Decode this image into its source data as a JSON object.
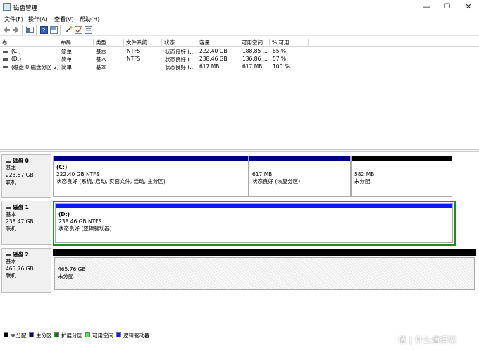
{
  "window": {
    "title": "磁盘管理",
    "controls": {
      "minimize": "—",
      "maximize": "☐",
      "close": "✕"
    }
  },
  "menu": [
    "文件(F)",
    "操作(A)",
    "查看(V)",
    "帮助(H)"
  ],
  "toolbar": [
    "back-icon",
    "forward-icon",
    "properties-icon",
    "help-icon",
    "console-icon",
    "connect-icon",
    "check-icon",
    "list-icon"
  ],
  "volume_table": {
    "columns": [
      "卷",
      "布局",
      "类型",
      "文件系统",
      "状态",
      "容量",
      "可用空间",
      "% 可用"
    ],
    "rows": [
      {
        "name": "(C:)",
        "layout": "简单",
        "type": "基本",
        "fs": "NTFS",
        "status": "状态良好 (...",
        "capacity": "222.40 GB",
        "free": "188.85 ...",
        "pct": "85 %"
      },
      {
        "name": "(D:)",
        "layout": "简单",
        "type": "基本",
        "fs": "NTFS",
        "status": "状态良好 (...",
        "capacity": "238.46 GB",
        "free": "136.86 ...",
        "pct": "57 %"
      },
      {
        "name": "(磁盘 0 磁盘分区 2)",
        "layout": "简单",
        "type": "基本",
        "fs": "",
        "status": "状态良好 (...",
        "capacity": "617 MB",
        "free": "617 MB",
        "pct": "100 %"
      }
    ]
  },
  "disks": [
    {
      "name": "磁盘 0",
      "kind": "基本",
      "size": "223.57 GB",
      "state": "联机",
      "partitions": [
        {
          "title": "(C:)",
          "line1": "222.40 GB NTFS",
          "line2": "状态良好 (系统, 启动, 页面文件, 活动, 主分区)",
          "bar": "#00007f"
        },
        {
          "title": "",
          "line1": "617 MB",
          "line2": "状态良好 (恢复分区)",
          "bar": "#00007f"
        },
        {
          "title": "",
          "line1": "582 MB",
          "line2": "未分配",
          "bar": "#000000"
        }
      ]
    },
    {
      "name": "磁盘 1",
      "kind": "基本",
      "size": "238.47 GB",
      "state": "联机",
      "partitions": [
        {
          "title": "(D:)",
          "line1": "238.46 GB NTFS",
          "line2": "状态良好 (逻辑驱动器)",
          "bar": "#1414ff"
        }
      ]
    },
    {
      "name": "磁盘 2",
      "kind": "基本",
      "size": "465.76 GB",
      "state": "联机",
      "partitions": [
        {
          "title": "",
          "line1": "465.76 GB",
          "line2": "未分配",
          "bar": "#000000"
        }
      ]
    }
  ],
  "legend": [
    {
      "label": "未分配",
      "color": "#000000"
    },
    {
      "label": "主分区",
      "color": "#00007f"
    },
    {
      "label": "扩展分区",
      "color": "#008000"
    },
    {
      "label": "可用空间",
      "color": "#33ff33"
    },
    {
      "label": "逻辑驱动器",
      "color": "#1414ff"
    }
  ],
  "watermark": "值 | 什么值得买"
}
